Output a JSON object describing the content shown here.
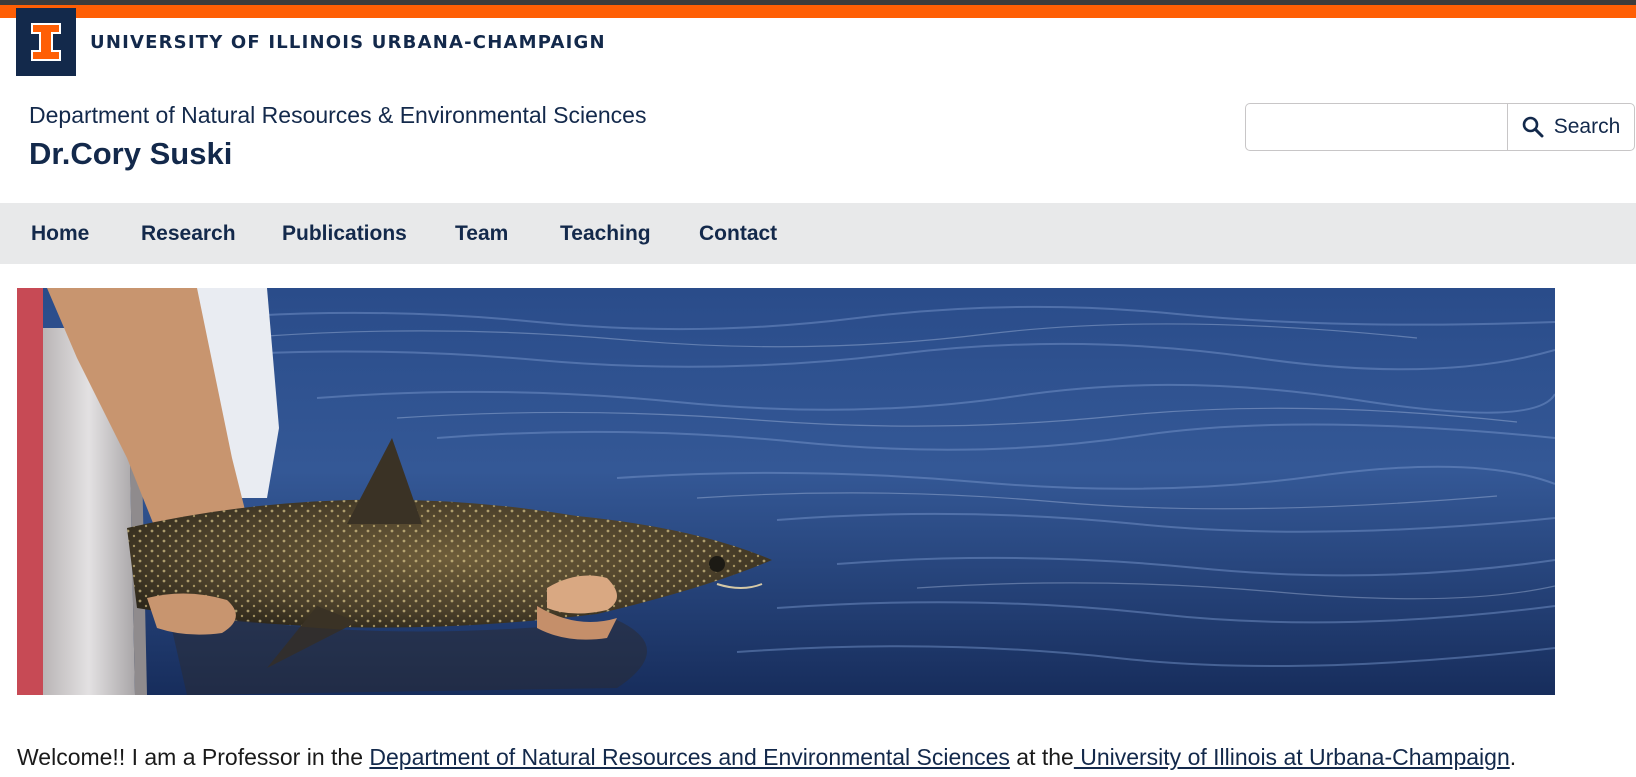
{
  "header": {
    "university_name": "UNIVERSITY OF ILLINOIS URBANA-CHAMPAIGN",
    "logo_icon": "block-i-icon",
    "department": "Department of Natural Resources & Environmental Sciences",
    "site_title": "Dr.Cory Suski"
  },
  "search": {
    "value": "",
    "placeholder": "",
    "button_label": "Search",
    "icon": "search-icon"
  },
  "nav": {
    "items": [
      {
        "label": "Home"
      },
      {
        "label": "Research"
      },
      {
        "label": "Publications"
      },
      {
        "label": "Team"
      },
      {
        "label": "Teaching"
      },
      {
        "label": "Contact"
      }
    ]
  },
  "content": {
    "welcome_prefix": "Welcome!! I am a Professor in the ",
    "dept_link": "Department of Natural Resources and Environmental Sciences",
    "welcome_middle": " at the",
    "uni_link": " University of Illinois at Urbana-Champaign",
    "welcome_suffix": "."
  },
  "colors": {
    "illini_orange": "#ff5f05",
    "illini_blue": "#13294b",
    "nav_background": "#e8e9ea"
  }
}
